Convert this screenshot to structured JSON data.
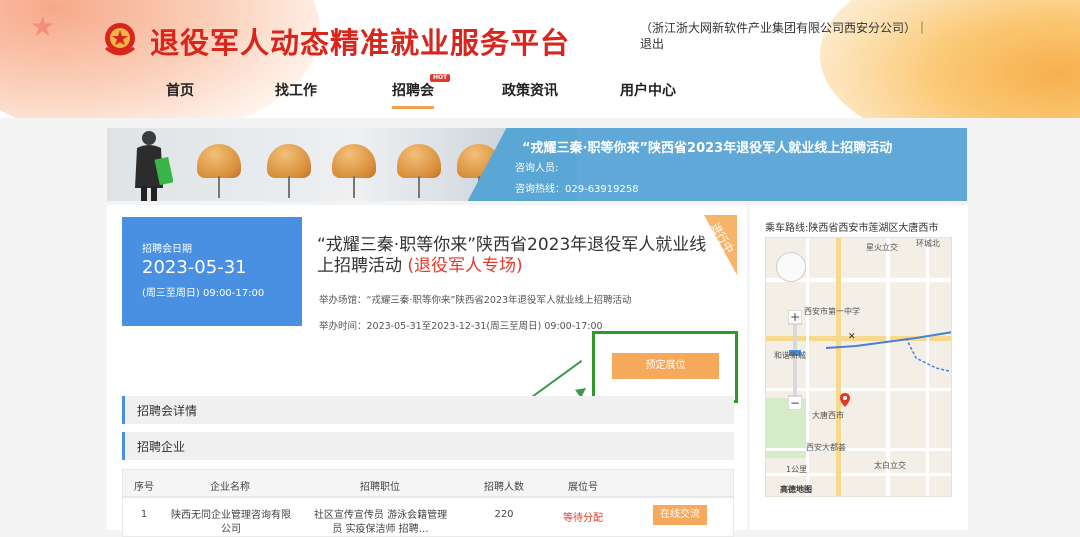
{
  "header": {
    "site_title": "退役军人动态精准就业服务平台",
    "user_info": "（浙江浙大网新软件产业集团有限公司西安分公司）｜ 退出"
  },
  "nav": {
    "items": [
      {
        "label": "首页"
      },
      {
        "label": "找工作"
      },
      {
        "label": "招聘会",
        "badge": "HOT",
        "active": true
      },
      {
        "label": "政策资讯"
      },
      {
        "label": "用户中心"
      }
    ]
  },
  "banner": {
    "title": "“戎耀三秦·职等你来”陕西省2023年退役军人就业线上招聘活动",
    "contact_label": "咨询人员:",
    "hotline": "咨询热线：029-63919258"
  },
  "event": {
    "date_label": "招聘会日期",
    "date": "2023-05-31",
    "time_range": "(周三至周日) 09:00-17:00",
    "title": "“戎耀三秦·职等你来”陕西省2023年退役军人就业线上招聘活动",
    "title_tag": "(退役军人专场)",
    "status": "进行中",
    "venue": "举办场馆：“戎耀三秦·职等你来”陕西省2023年退役军人就业线上招聘活动",
    "time": "举办时间：2023-05-31至2023-12-31(周三至周日) 09:00-17:00",
    "book_button": "预定展位"
  },
  "sections": {
    "details": "招聘会详情",
    "companies": "招聘企业"
  },
  "table": {
    "headers": [
      "序号",
      "企业名称",
      "招聘职位",
      "招聘人数",
      "展位号"
    ],
    "rows": [
      {
        "index": "1",
        "company": "陕西无同企业管理咨询有限公司",
        "positions": "社区宣传宣传员 游泳会籍管理员 实疫保洁师 招聘…",
        "count": "220",
        "booth": "等待分配",
        "action": "在线交流"
      }
    ]
  },
  "map": {
    "address": "乘车路线:陕西省西安市莲湖区大唐西市",
    "labels": {
      "xingguo": "星火立交",
      "huanbei": "环城北",
      "xian_no1": "西安市第一中学",
      "hexie": "和谐新城",
      "datang": "大唐西市",
      "dadu": "西安大都荟",
      "taibai": "太白立交",
      "scale": "1公里",
      "brand": "高德地图"
    }
  },
  "colors": {
    "brand_red": "#d8261c",
    "blue": "#4a90e2",
    "orange": "#f6a85b",
    "green_highlight": "#2e9a2e"
  }
}
